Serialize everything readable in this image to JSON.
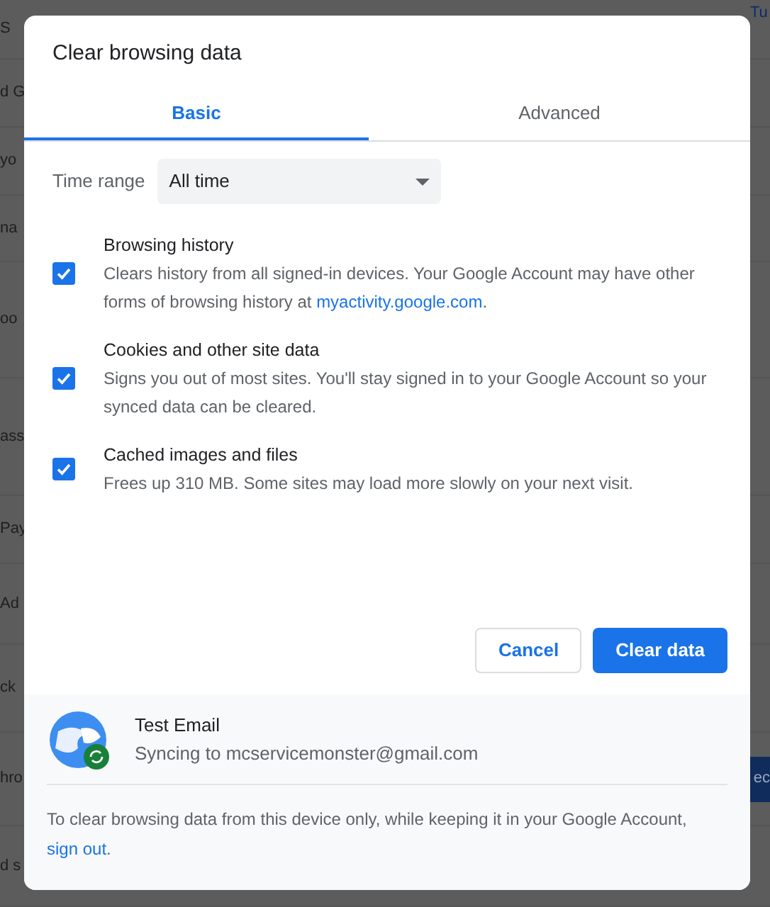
{
  "background_page": {
    "rows": [
      {
        "left": "S",
        "link": "Tu"
      },
      {
        "left": "d G"
      },
      {
        "left": "yo"
      },
      {
        "left": "na"
      },
      {
        "left": "oo"
      },
      {
        "left": "ass"
      },
      {
        "left": "Pay"
      },
      {
        "left": "Ad"
      },
      {
        "left": "ck"
      },
      {
        "left": "hro",
        "button": "ec"
      },
      {
        "left": "d s"
      }
    ]
  },
  "dialog": {
    "title": "Clear browsing data",
    "tabs": [
      {
        "label": "Basic",
        "selected": true
      },
      {
        "label": "Advanced",
        "selected": false
      }
    ],
    "time_range": {
      "label": "Time range",
      "value": "All time"
    },
    "items": [
      {
        "title": "Browsing history",
        "description": "Clears history from all signed-in devices. Your Google Account may have other forms of browsing history at ",
        "link": "myactivity.google.com",
        "after": ".",
        "checked": true
      },
      {
        "title": "Cookies and other site data",
        "description": "Signs you out of most sites. You'll stay signed in to your Google Account so your synced data can be cleared.",
        "checked": true
      },
      {
        "title": "Cached images and files",
        "description": "Frees up 310 MB. Some sites may load more slowly on your next visit.",
        "checked": true
      }
    ],
    "buttons": [
      {
        "label": "Cancel",
        "kind": "secondary"
      },
      {
        "label": "Clear data",
        "kind": "primary"
      }
    ],
    "account": {
      "name": "Test Email",
      "status": "Syncing to mcservicemonster@gmail.com"
    },
    "footer": {
      "text": "To clear browsing data from this device only, while keeping it in your Google Account, ",
      "link": "sign out",
      "after": "."
    }
  }
}
